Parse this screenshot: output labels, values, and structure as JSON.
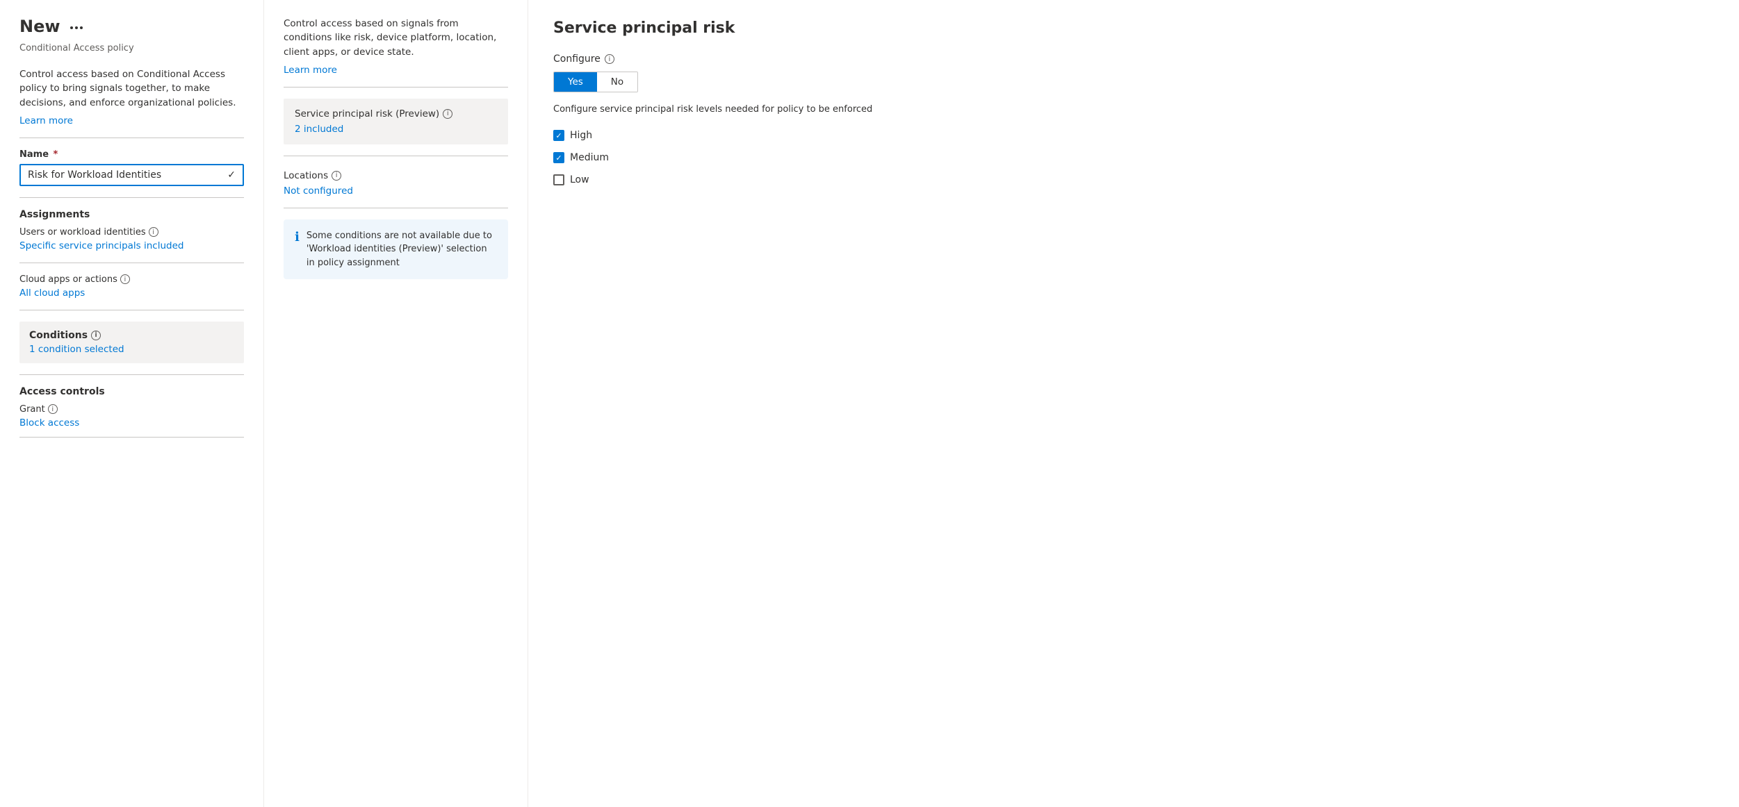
{
  "mainPanel": {
    "title": "New",
    "subtitle": "Conditional Access policy",
    "description": "Control access based on Conditional Access policy to bring signals together, to make decisions, and enforce organizational policies.",
    "learnMoreLabel": "Learn more",
    "nameLabel": "Name",
    "nameValue": "Risk for Workload Identities",
    "assignmentsLabel": "Assignments",
    "usersLabel": "Users or workload identities",
    "usersValue": "Specific service principals included",
    "cloudAppsLabel": "Cloud apps or actions",
    "cloudAppsValue": "All cloud apps",
    "conditionsLabel": "Conditions",
    "conditionSelectedValue": "1 condition selected",
    "accessControlsLabel": "Access controls",
    "grantLabel": "Grant",
    "grantValue": "Block access"
  },
  "middlePanel": {
    "description": "Control access based on signals from conditions like risk, device platform, location, client apps, or device state.",
    "learnMoreLabel": "Learn more",
    "servicePrincipalRiskLabel": "Service principal risk (Preview)",
    "servicePrincipalRiskValue": "2 included",
    "locationsLabel": "Locations",
    "locationsValue": "Not configured",
    "infoBoxText": "Some conditions are not available due to 'Workload identities (Preview)' selection in policy assignment"
  },
  "rightPanel": {
    "title": "Service principal risk",
    "configureLabel": "Configure",
    "yesLabel": "Yes",
    "noLabel": "No",
    "configureDescription": "Configure service principal risk levels needed for policy to be enforced",
    "checkboxes": [
      {
        "label": "High",
        "checked": true
      },
      {
        "label": "Medium",
        "checked": true
      },
      {
        "label": "Low",
        "checked": false
      }
    ]
  }
}
